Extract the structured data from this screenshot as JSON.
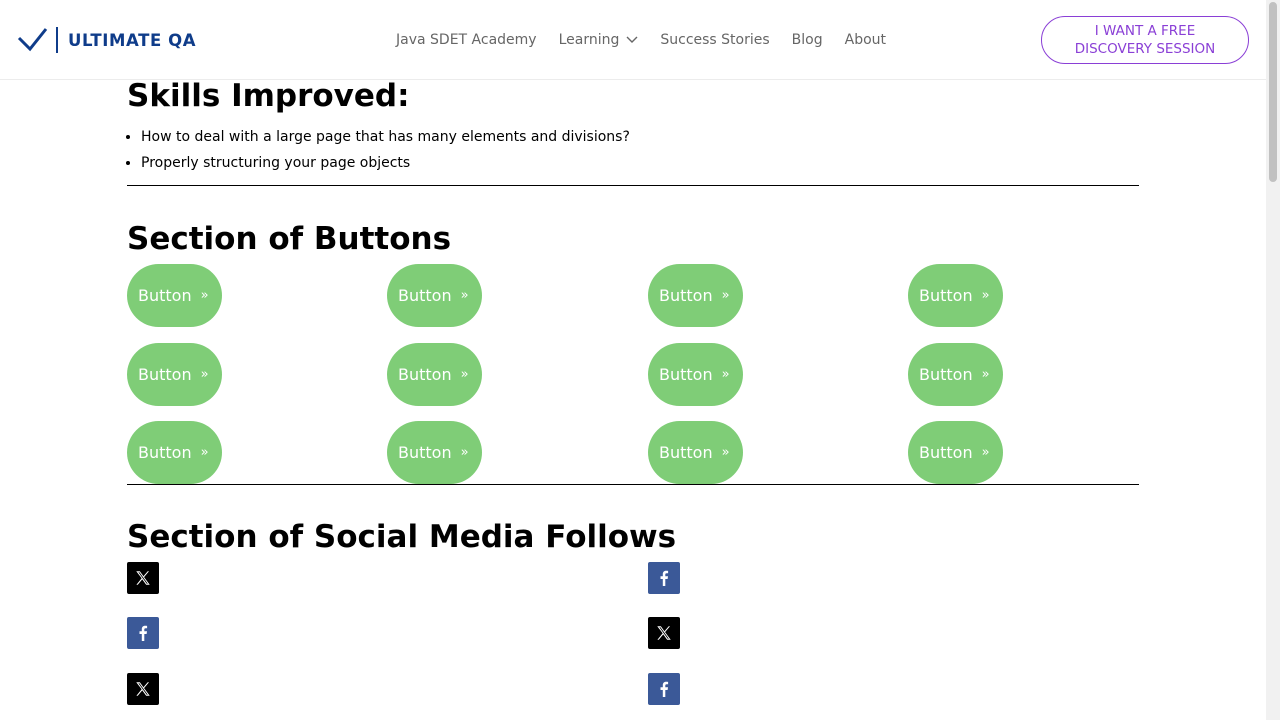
{
  "header": {
    "logo_text": "ULTIMATE QA",
    "nav": [
      {
        "label": "Java SDET Academy"
      },
      {
        "label": "Learning"
      },
      {
        "label": "Success Stories"
      },
      {
        "label": "Blog"
      },
      {
        "label": "About"
      }
    ],
    "cta_label": "I WANT A FREE\nDISCOVERY SESSION"
  },
  "skills": {
    "title": "Skills Improved:",
    "items": [
      "How to deal with a large page that has many elements and divisions?",
      "Properly structuring your page objects"
    ]
  },
  "buttons_section": {
    "title": "Section of Buttons",
    "button_label": "Button",
    "arrow": "»",
    "rows": 3,
    "columns": 4
  },
  "social_section": {
    "title": "Section of Social Media Follows",
    "left_column": [
      "x-icon",
      "facebook-icon",
      "x-icon"
    ],
    "right_column": [
      "facebook-icon",
      "x-icon",
      "facebook-icon"
    ]
  },
  "colors": {
    "brand_blue": "#0f3c8a",
    "cta_purple": "#8a3fd6",
    "button_green": "#7fcd77",
    "facebook_blue": "#3b5998",
    "x_black": "#000000"
  }
}
